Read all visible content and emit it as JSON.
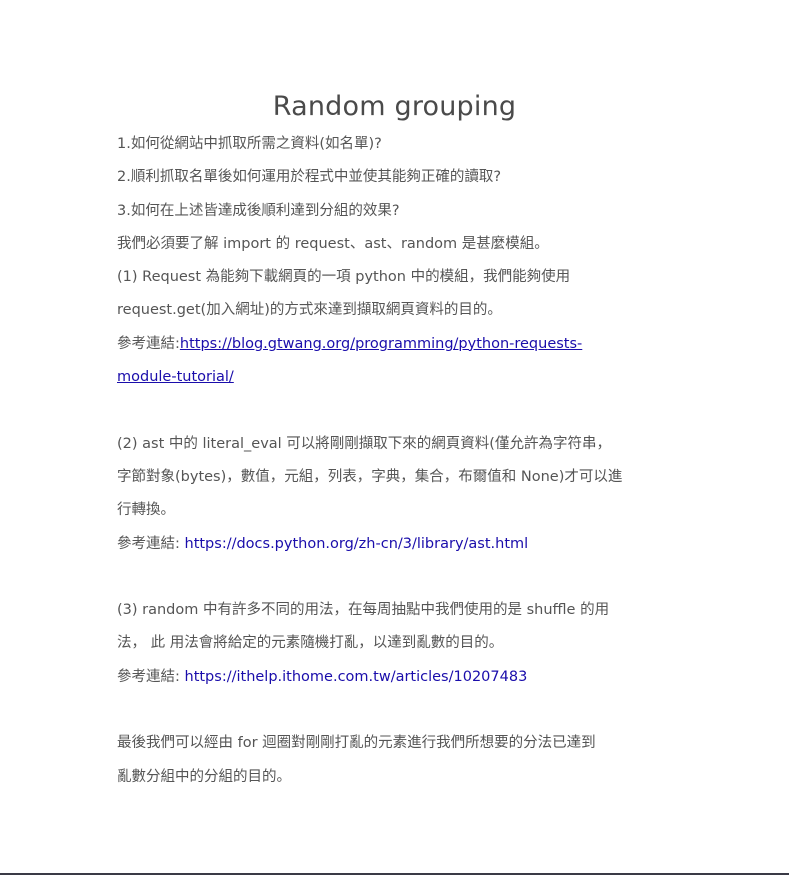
{
  "title": "Random grouping",
  "questions": [
    "1.如何從網站中抓取所需之資料(如名單)?",
    "2.順利抓取名單後如何運用於程式中並使其能夠正確的讀取?",
    "3.如何在上述皆達成後順利達到分組的效果?"
  ],
  "intro": "我們必須要了解  import  的  request、ast、random  是甚麼模組。",
  "request_section": {
    "line1": "(1) Request  為能夠下載網頁的一項  python  中的模組，我們能夠使用",
    "line2": "request.get(加入網址)的方式來達到擷取網頁資料的目的。",
    "ref_label": "參考連結:",
    "ref_link_line1": "https://blog.gtwang.org/programming/python-requests-",
    "ref_link_line2": "module-tutorial/"
  },
  "ast_section": {
    "line1": "(2) ast  中的  literal_eval  可以將剛剛擷取下來的網頁資料(僅允許為字符串，",
    "line2": "字節對象(bytes)，數值，元組，列表，字典，集合，布爾值和  None)才可以進",
    "line3": "行轉換。",
    "ref_label": "參考連結: ",
    "ref_link": "https://docs.python.org/zh-cn/3/library/ast.html"
  },
  "random_section": {
    "line1": "(3) random  中有許多不同的用法，在每周抽點中我們使用的是  shuffle  的用",
    "line2": "法，  此  用法會將給定的元素隨機打亂，以達到亂數的目的。",
    "ref_label": "參考連結: ",
    "ref_link": "https://ithelp.ithome.com.tw/articles/10207483"
  },
  "conclusion": {
    "line1": "最後我們可以經由  for  迴圈對剛剛打亂的元素進行我們所想要的分法已達到",
    "line2": "亂數分組中的分組的目的。"
  },
  "colors": {
    "text": "#555555",
    "title": "#4a4a4a",
    "link": "#1a0dab",
    "bottom_rule": "#3a3a46"
  }
}
